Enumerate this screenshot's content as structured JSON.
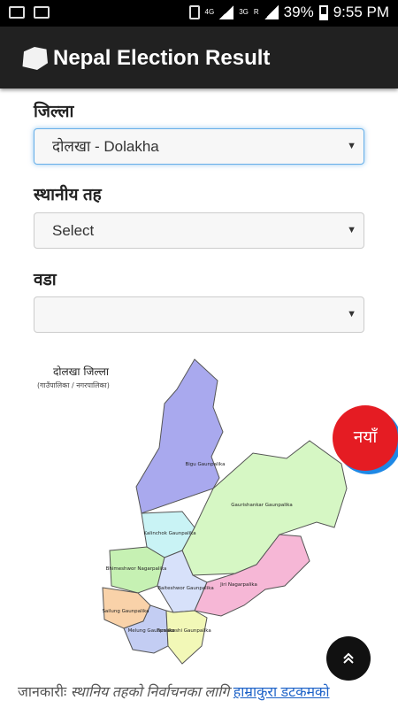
{
  "status": {
    "net_4g": "4G",
    "net_3g": "3G",
    "roaming": "R",
    "battery": "39%",
    "time": "9:55 PM"
  },
  "app": {
    "title": "Nepal Election Result"
  },
  "form": {
    "district_label": "जिल्ला",
    "district_value": "दोलखा - Dolakha",
    "local_level_label": "स्थानीय तह",
    "local_level_value": "Select",
    "ward_label": "वडा",
    "ward_value": ""
  },
  "map": {
    "title": "दोलखा जिल्ला",
    "subtitle": "(गाउँपालिका / नगरपालिका)",
    "regions": [
      {
        "name": "Bigu Gaunpalika",
        "color": "#a9a9ee"
      },
      {
        "name": "Gaurishankar Gaunpalika",
        "color": "#d6f7c4"
      },
      {
        "name": "Kalinchok Gaunpalika",
        "color": "#c9f3f5"
      },
      {
        "name": "Bhimeshwor Nagarpalika",
        "color": "#c6f1b3"
      },
      {
        "name": "Baiteshwor Gaunpalika",
        "color": "#d7e1fa"
      },
      {
        "name": "Jiri Nagarpalika",
        "color": "#f6b7d6"
      },
      {
        "name": "Sailung Gaunpalika",
        "color": "#f9d2a9"
      },
      {
        "name": "Melung Gaunpalika",
        "color": "#c3cdf3"
      },
      {
        "name": "Tamakoshi Gaunpalika",
        "color": "#f2f8b7"
      }
    ]
  },
  "fab_new": "नयाँ",
  "fab_up_icon": "double-chevron-up",
  "info": {
    "prefix": "जानकारीः ",
    "italic": "स्थानिय तहको निर्वाचनका लागि ",
    "link": "हाम्राकुरा डटकमको"
  }
}
